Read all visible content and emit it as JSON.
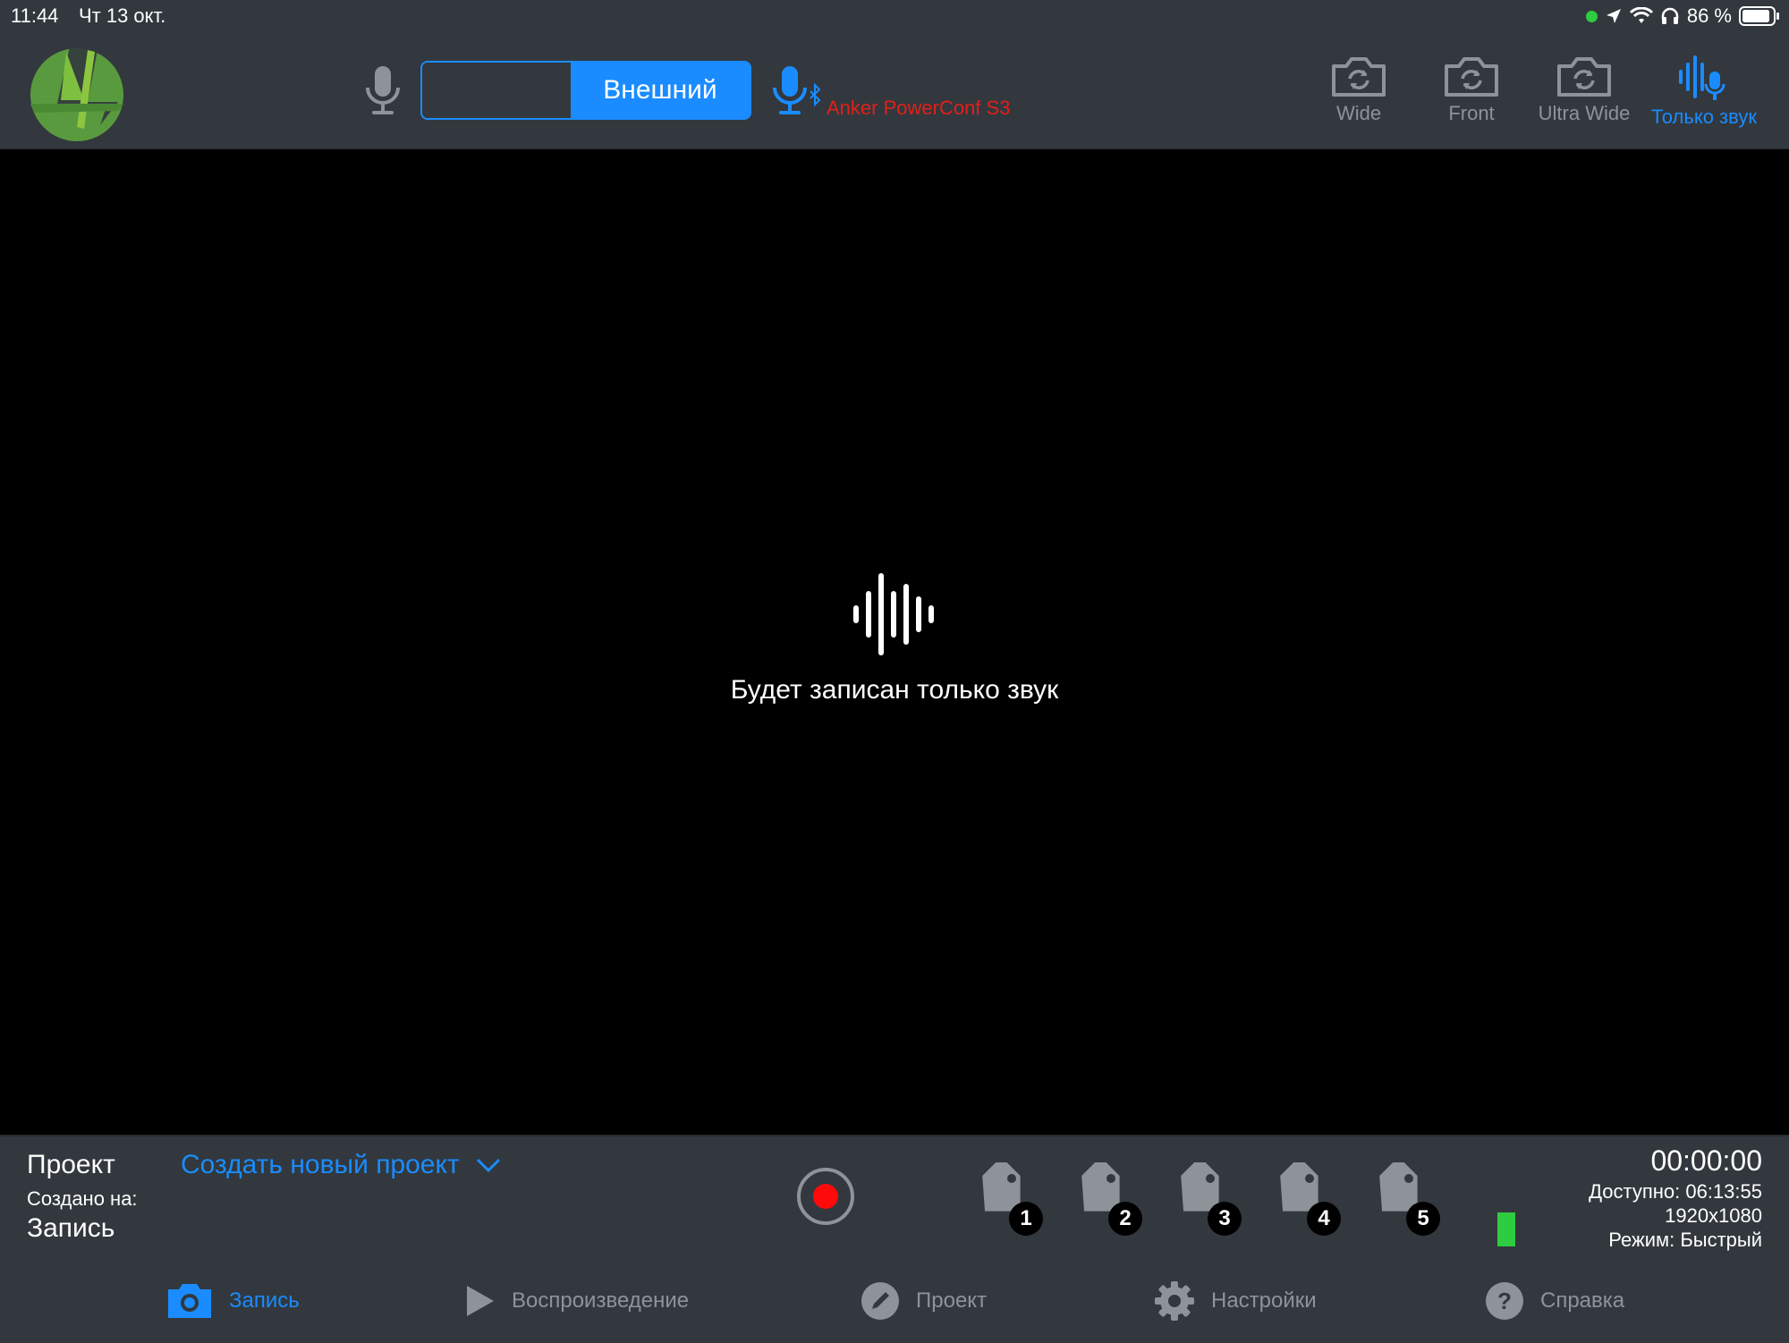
{
  "status_bar": {
    "time": "11:44",
    "date": "Чт 13 окт.",
    "battery_percent": "86 %"
  },
  "toolbar": {
    "input_mode_selected": "Внешний",
    "external_device_name": "Anker PowerConf S3",
    "camera_options": [
      {
        "label": "Wide",
        "active": false
      },
      {
        "label": "Front",
        "active": false
      },
      {
        "label": "Ultra Wide",
        "active": false
      },
      {
        "label": "Только звук",
        "active": true
      }
    ]
  },
  "viewport": {
    "message": "Будет записан только звук"
  },
  "bottom": {
    "project_label": "Проект",
    "project_selector": "Создать новый проект",
    "created_on_label": "Создано на:",
    "created_on_value": "Запись",
    "timecode": "00:00:00",
    "available": "Доступно: 06:13:55",
    "resolution": "1920x1080",
    "mode": "Режим: Быстрый",
    "tags": [
      "1",
      "2",
      "3",
      "4",
      "5"
    ],
    "audio_level": 1.0
  },
  "nav": {
    "record": "Запись",
    "playback": "Воспроизведение",
    "project": "Проект",
    "settings": "Настройки",
    "help": "Справка"
  },
  "colors": {
    "accent": "#1a8cff",
    "bar_bg": "#32383e",
    "record_red": "#ff0a0a",
    "level_green": "#2ecc40",
    "device_red": "#e0201a",
    "inactive": "#8e9399"
  }
}
